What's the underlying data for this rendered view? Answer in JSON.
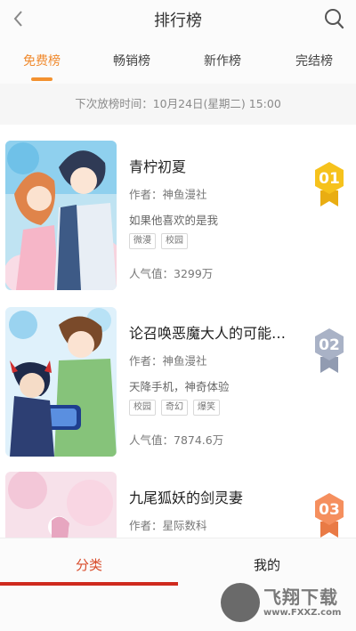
{
  "header": {
    "title": "排行榜",
    "back_icon": "chevron-left-icon",
    "search_icon": "search-icon"
  },
  "tabs": [
    {
      "label": "免费榜",
      "active": true
    },
    {
      "label": "畅销榜",
      "active": false
    },
    {
      "label": "新作榜",
      "active": false
    },
    {
      "label": "完结榜",
      "active": false
    }
  ],
  "schedule_text": "下次放榜时间：10月24日(星期二) 15:00",
  "books": [
    {
      "rank": "01",
      "title": "青柠初夏",
      "author": "作者：神鱼漫社",
      "description": "如果他喜欢的是我",
      "tags": [
        "微漫",
        "校园"
      ],
      "popularity": "人气值：3299万",
      "badge_color": "#f6c21c"
    },
    {
      "rank": "02",
      "title": "论召唤恶魔大人的可能…",
      "author": "作者：神鱼漫社",
      "description": "天降手机，神奇体验",
      "tags": [
        "校园",
        "奇幻",
        "爆笑"
      ],
      "popularity": "人气值：7874.6万",
      "badge_color": "#a9b2c6"
    },
    {
      "rank": "03",
      "title": "九尾狐妖的剑灵妻",
      "author": "作者：星际数科",
      "description": "",
      "tags": [],
      "popularity": "",
      "badge_color": "#f58f5e"
    }
  ],
  "bottom_nav": [
    {
      "label": "分类",
      "active": true
    },
    {
      "label": "我的",
      "active": false
    }
  ],
  "watermark": {
    "text": "飞翔下载",
    "url": "www.FXXZ.com"
  },
  "colors": {
    "accent": "#f08a2e",
    "nav_active": "#cf2a1e"
  }
}
